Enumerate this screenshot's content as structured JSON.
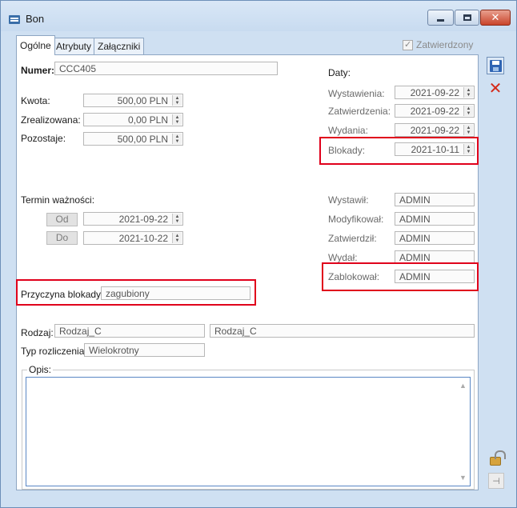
{
  "window": {
    "title": "Bon",
    "minimize_label": "",
    "close_label": "✕"
  },
  "tabs": [
    {
      "label": "Ogólne"
    },
    {
      "label": "Atrybuty"
    },
    {
      "label": "Załączniki"
    }
  ],
  "zatwierdzony": {
    "label": "Zatwierdzony",
    "checked": true
  },
  "numer": {
    "label": "Numer:",
    "value": "CCC405"
  },
  "amounts": {
    "kwota": {
      "label": "Kwota:",
      "value": "500,00 PLN"
    },
    "zrealizowana": {
      "label": "Zrealizowana:",
      "value": "0,00 PLN"
    },
    "pozostaje": {
      "label": "Pozostaje:",
      "value": "500,00 PLN"
    }
  },
  "termin": {
    "label": "Termin ważności:",
    "od": {
      "button": "Od",
      "value": "2021-09-22"
    },
    "do": {
      "button": "Do",
      "value": "2021-10-22"
    }
  },
  "przyczyna": {
    "label": "Przyczyna blokady:",
    "value": "zagubiony"
  },
  "daty": {
    "label": "Daty:",
    "wystawienia": {
      "label": "Wystawienia:",
      "value": "2021-09-22"
    },
    "zatwierdzenia": {
      "label": "Zatwierdzenia:",
      "value": "2021-09-22"
    },
    "wydania": {
      "label": "Wydania:",
      "value": "2021-09-22"
    },
    "blokady": {
      "label": "Blokady:",
      "value": "2021-10-11"
    }
  },
  "users": {
    "wystawil": {
      "label": "Wystawił:",
      "value": "ADMIN"
    },
    "modyfikowal": {
      "label": "Modyfikował:",
      "value": "ADMIN"
    },
    "zatwierdzil": {
      "label": "Zatwierdził:",
      "value": "ADMIN"
    },
    "wydal": {
      "label": "Wydał:",
      "value": "ADMIN"
    },
    "zablokowal": {
      "label": "Zablokował:",
      "value": "ADMIN"
    }
  },
  "rodzaj": {
    "label": "Rodzaj:",
    "value1": "Rodzaj_C",
    "value2": "Rodzaj_C"
  },
  "typ_rozliczenia": {
    "label": "Typ rozliczenia:",
    "value": "Wielokrotny"
  },
  "opis": {
    "label": "Opis:",
    "value": ""
  },
  "colors": {
    "highlight": "#e0001b",
    "accent": "#2f64b3",
    "titlebar": "#c8dbf0"
  },
  "icons": [
    "app-icon",
    "minimize-icon",
    "maximize-icon",
    "close-icon",
    "save-icon",
    "cancel-icon",
    "lock-icon",
    "pin-icon",
    "checkmark-icon",
    "spinner-icon"
  ]
}
